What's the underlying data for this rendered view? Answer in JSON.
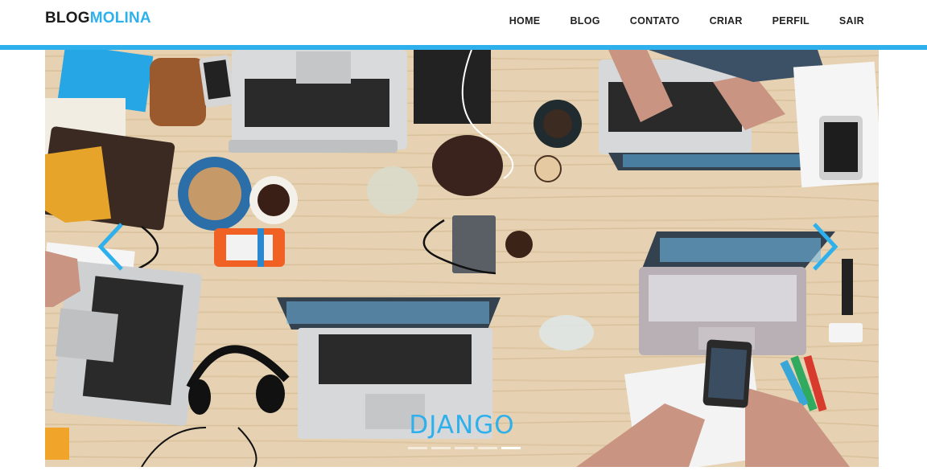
{
  "brand": {
    "part1": "BLOG",
    "part2": "MOLINA"
  },
  "nav": {
    "items": [
      "HOME",
      "BLOG",
      "CONTATO",
      "CRIAR",
      "PERFIL",
      "SAIR"
    ]
  },
  "carousel": {
    "caption": "DJANGO",
    "slide_count": 5,
    "active_index": 4,
    "prev_icon": "chevron-left-icon",
    "next_icon": "chevron-right-icon"
  },
  "colors": {
    "accent": "#2eb0ec",
    "brand_dark": "#1c1c1c",
    "nav_text": "#222222"
  }
}
